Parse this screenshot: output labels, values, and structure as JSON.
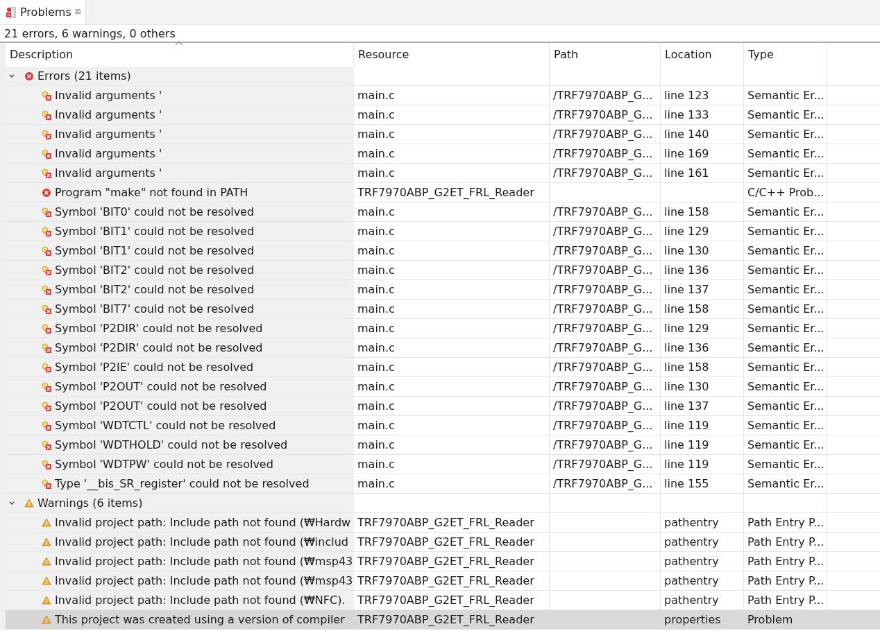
{
  "tab": {
    "title": "Problems",
    "close": "⊠"
  },
  "summary": "21 errors, 6 warnings, 0 others",
  "columns": [
    "Description",
    "Resource",
    "Path",
    "Location",
    "Type"
  ],
  "groups": [
    {
      "kind": "error",
      "label": "Errors (21 items)",
      "expanded": true,
      "children": [
        {
          "kind": "semantic",
          "selected": false,
          "cells": [
            "Invalid arguments '",
            "main.c",
            "/TRF7970ABP_G...",
            "line 123",
            "Semantic Er..."
          ]
        },
        {
          "kind": "semantic",
          "selected": false,
          "cells": [
            "Invalid arguments '",
            "main.c",
            "/TRF7970ABP_G...",
            "line 133",
            "Semantic Er..."
          ]
        },
        {
          "kind": "semantic",
          "selected": false,
          "cells": [
            "Invalid arguments '",
            "main.c",
            "/TRF7970ABP_G...",
            "line 140",
            "Semantic Er..."
          ]
        },
        {
          "kind": "semantic",
          "selected": false,
          "cells": [
            "Invalid arguments '",
            "main.c",
            "/TRF7970ABP_G...",
            "line 169",
            "Semantic Er..."
          ]
        },
        {
          "kind": "semantic",
          "selected": false,
          "cells": [
            "Invalid arguments '",
            "main.c",
            "/TRF7970ABP_G...",
            "line 161",
            "Semantic Er..."
          ]
        },
        {
          "kind": "error",
          "selected": false,
          "cells": [
            "Program \"make\" not found in PATH",
            "TRF7970ABP_G2ET_FRL_Reader",
            "",
            "",
            "C/C++ Prob..."
          ]
        },
        {
          "kind": "semantic",
          "selected": false,
          "cells": [
            "Symbol 'BIT0' could not be resolved",
            "main.c",
            "/TRF7970ABP_G...",
            "line 158",
            "Semantic Er..."
          ]
        },
        {
          "kind": "semantic",
          "selected": false,
          "cells": [
            "Symbol 'BIT1' could not be resolved",
            "main.c",
            "/TRF7970ABP_G...",
            "line 129",
            "Semantic Er..."
          ]
        },
        {
          "kind": "semantic",
          "selected": false,
          "cells": [
            "Symbol 'BIT1' could not be resolved",
            "main.c",
            "/TRF7970ABP_G...",
            "line 130",
            "Semantic Er..."
          ]
        },
        {
          "kind": "semantic",
          "selected": false,
          "cells": [
            "Symbol 'BIT2' could not be resolved",
            "main.c",
            "/TRF7970ABP_G...",
            "line 136",
            "Semantic Er..."
          ]
        },
        {
          "kind": "semantic",
          "selected": false,
          "cells": [
            "Symbol 'BIT2' could not be resolved",
            "main.c",
            "/TRF7970ABP_G...",
            "line 137",
            "Semantic Er..."
          ]
        },
        {
          "kind": "semantic",
          "selected": false,
          "cells": [
            "Symbol 'BIT7' could not be resolved",
            "main.c",
            "/TRF7970ABP_G...",
            "line 158",
            "Semantic Er..."
          ]
        },
        {
          "kind": "semantic",
          "selected": false,
          "cells": [
            "Symbol 'P2DIR' could not be resolved",
            "main.c",
            "/TRF7970ABP_G...",
            "line 129",
            "Semantic Er..."
          ]
        },
        {
          "kind": "semantic",
          "selected": false,
          "cells": [
            "Symbol 'P2DIR' could not be resolved",
            "main.c",
            "/TRF7970ABP_G...",
            "line 136",
            "Semantic Er..."
          ]
        },
        {
          "kind": "semantic",
          "selected": false,
          "cells": [
            "Symbol 'P2IE' could not be resolved",
            "main.c",
            "/TRF7970ABP_G...",
            "line 158",
            "Semantic Er..."
          ]
        },
        {
          "kind": "semantic",
          "selected": false,
          "cells": [
            "Symbol 'P2OUT' could not be resolved",
            "main.c",
            "/TRF7970ABP_G...",
            "line 130",
            "Semantic Er..."
          ]
        },
        {
          "kind": "semantic",
          "selected": false,
          "cells": [
            "Symbol 'P2OUT' could not be resolved",
            "main.c",
            "/TRF7970ABP_G...",
            "line 137",
            "Semantic Er..."
          ]
        },
        {
          "kind": "semantic",
          "selected": false,
          "cells": [
            "Symbol 'WDTCTL' could not be resolved",
            "main.c",
            "/TRF7970ABP_G...",
            "line 119",
            "Semantic Er..."
          ]
        },
        {
          "kind": "semantic",
          "selected": false,
          "cells": [
            "Symbol 'WDTHOLD' could not be resolved",
            "main.c",
            "/TRF7970ABP_G...",
            "line 119",
            "Semantic Er..."
          ]
        },
        {
          "kind": "semantic",
          "selected": false,
          "cells": [
            "Symbol 'WDTPW' could not be resolved",
            "main.c",
            "/TRF7970ABP_G...",
            "line 119",
            "Semantic Er..."
          ]
        },
        {
          "kind": "semantic",
          "selected": false,
          "cells": [
            "Type '__bis_SR_register' could not be resolved",
            "main.c",
            "/TRF7970ABP_G...",
            "line 155",
            "Semantic Er..."
          ]
        }
      ]
    },
    {
      "kind": "warning",
      "label": "Warnings (6 items)",
      "expanded": true,
      "children": [
        {
          "kind": "warning",
          "selected": false,
          "cells": [
            "Invalid project path: Include path not found (₩Hardw",
            "TRF7970ABP_G2ET_FRL_Reader",
            "",
            "pathentry",
            "Path Entry P..."
          ]
        },
        {
          "kind": "warning",
          "selected": false,
          "cells": [
            "Invalid project path: Include path not found (₩includ",
            "TRF7970ABP_G2ET_FRL_Reader",
            "",
            "pathentry",
            "Path Entry P..."
          ]
        },
        {
          "kind": "warning",
          "selected": false,
          "cells": [
            "Invalid project path: Include path not found (₩msp43",
            "TRF7970ABP_G2ET_FRL_Reader",
            "",
            "pathentry",
            "Path Entry P..."
          ]
        },
        {
          "kind": "warning",
          "selected": false,
          "cells": [
            "Invalid project path: Include path not found (₩msp43",
            "TRF7970ABP_G2ET_FRL_Reader",
            "",
            "pathentry",
            "Path Entry P..."
          ]
        },
        {
          "kind": "warning",
          "selected": false,
          "cells": [
            "Invalid project path: Include path not found (₩NFC).",
            "TRF7970ABP_G2ET_FRL_Reader",
            "",
            "pathentry",
            "Path Entry P..."
          ]
        },
        {
          "kind": "warning",
          "selected": true,
          "cells": [
            "This project was created using a version of compiler",
            "TRF7970ABP_G2ET_FRL_Reader",
            "",
            "properties",
            "Problem"
          ]
        }
      ]
    }
  ]
}
